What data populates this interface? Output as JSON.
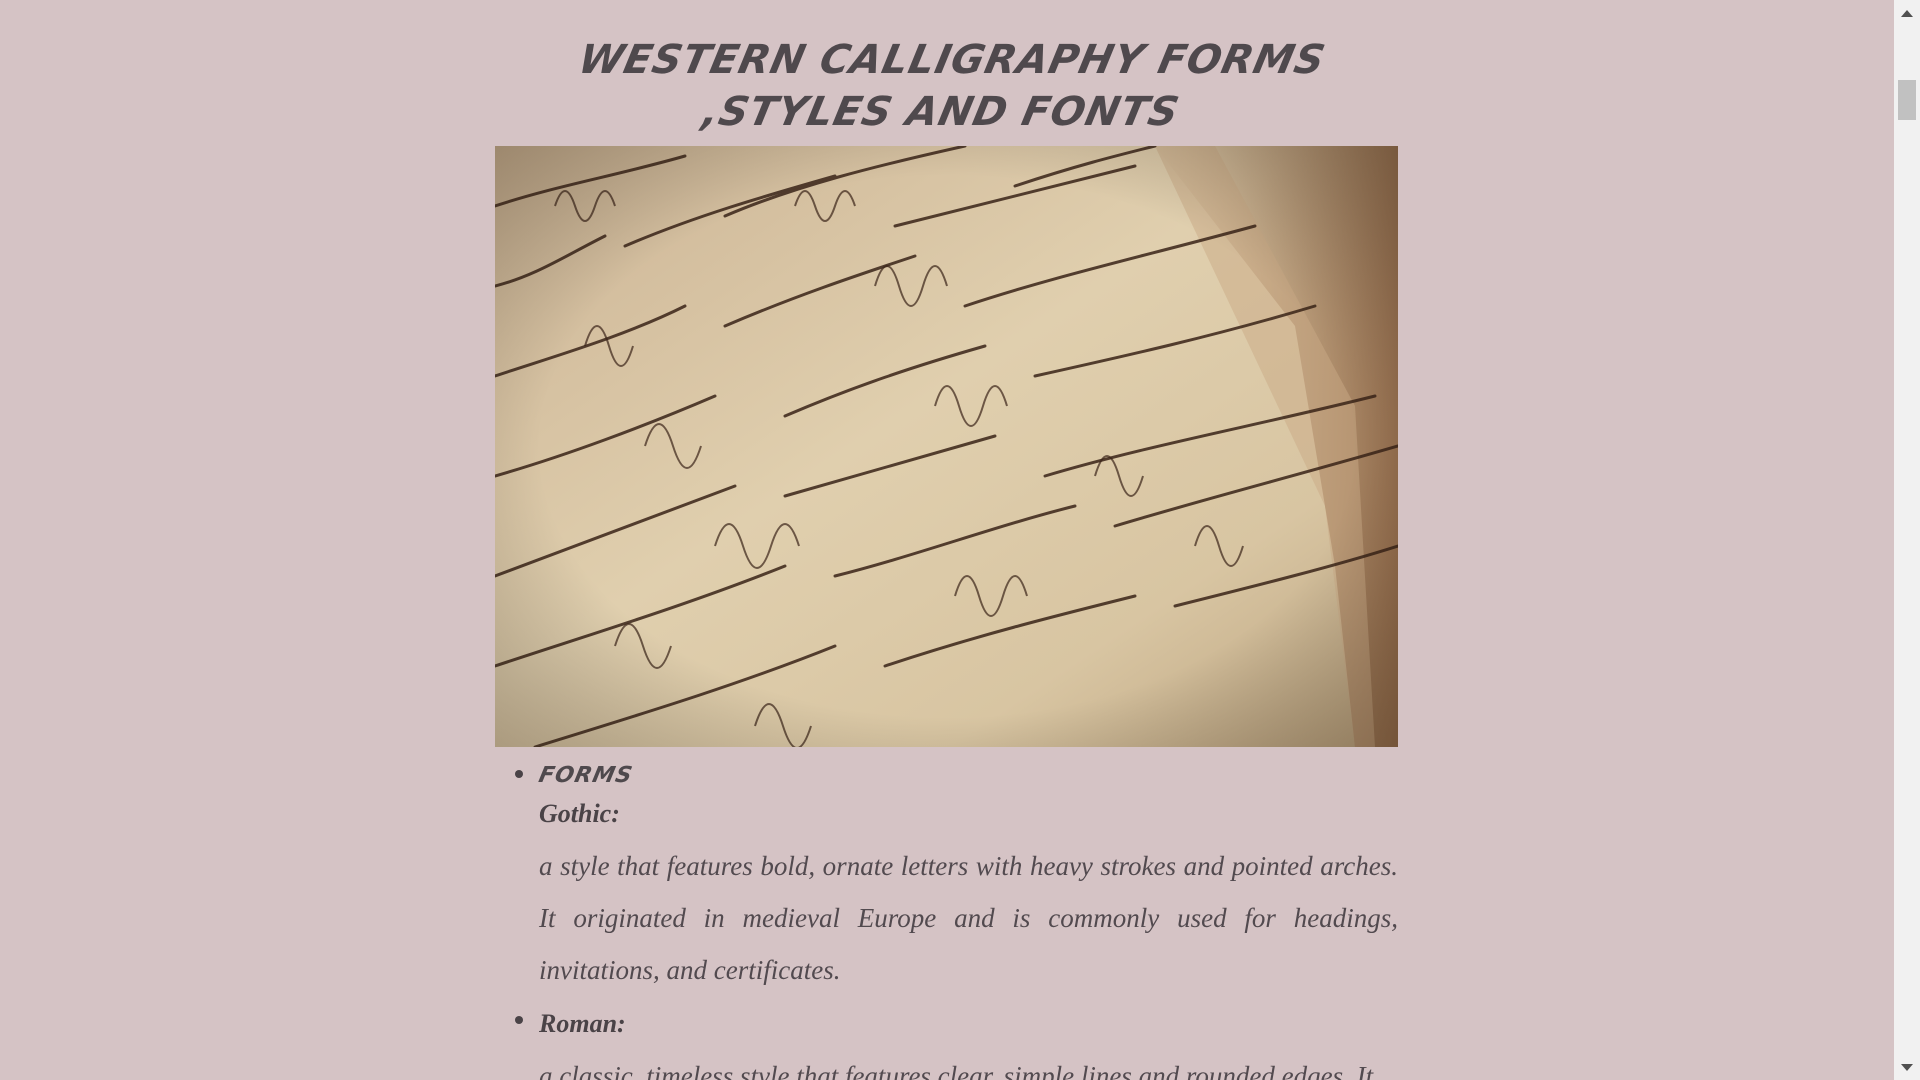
{
  "page": {
    "title": "WESTERN CALLIGRAPHY FORMS ,STYLES AND FONTS"
  },
  "hero_image": {
    "description_icon": "handwritten-script-image"
  },
  "sections": [
    {
      "heading": "FORMS",
      "term": "Gothic:",
      "description": "a style that features bold, ornate letters with heavy strokes and pointed arches. It originated in medieval Europe and is commonly used for headings, invitations, and certificates."
    },
    {
      "heading": "",
      "term": "Roman:",
      "description": "a classic, timeless style that features clear, simple lines and rounded edges. It"
    }
  ],
  "colors": {
    "background": "#d5c3c5",
    "text": "#4a4347",
    "scrollbar_track": "#f1f1f1",
    "scrollbar_thumb": "#c1c1c1"
  }
}
